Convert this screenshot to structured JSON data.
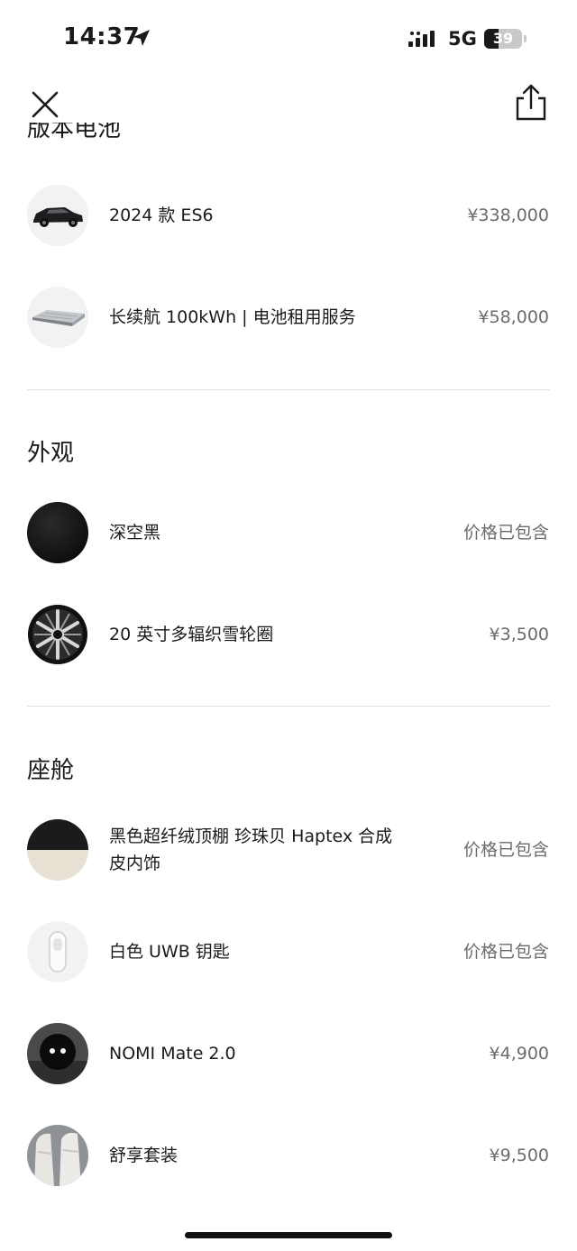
{
  "status_bar": {
    "time": "14:37",
    "network": "5G",
    "battery": "39",
    "battery_fraction": 0.39
  },
  "nav": {
    "close_icon": "close-icon",
    "share_icon": "share-icon"
  },
  "clipped_section_title": "版本电池",
  "version_items": [
    {
      "name": "2024 款 ES6",
      "price": "¥338,000",
      "thumb": "suv-car-thumbnail"
    },
    {
      "name": "长续航 100kWh | 电池租用服务",
      "price": "¥58,000",
      "thumb": "battery-pack-thumbnail"
    }
  ],
  "exterior": {
    "title": "外观",
    "items": [
      {
        "name": "深空黑",
        "price": "价格已包含",
        "thumb": "black-paint-swatch"
      },
      {
        "name": "20 英寸多辐织雪轮圈",
        "price": "¥3,500",
        "thumb": "wheel-rim-thumbnail"
      }
    ]
  },
  "cabin": {
    "title": "座舱",
    "items": [
      {
        "name": "黑色超纤绒顶棚 珍珠贝 Haptex 合成皮内饰",
        "price": "价格已包含",
        "thumb": "interior-color-swatch"
      },
      {
        "name": "白色 UWB 钥匙",
        "price": "价格已包含",
        "thumb": "uwb-key-thumbnail"
      },
      {
        "name": "NOMI Mate 2.0",
        "price": "¥4,900",
        "thumb": "nomi-robot-thumbnail"
      },
      {
        "name": "舒享套装",
        "price": "¥9,500",
        "thumb": "seat-package-thumbnail"
      }
    ]
  },
  "colors": {
    "text": "#1a1a1a",
    "muted": "#6b6b6b",
    "divider": "#e2e2e2"
  }
}
